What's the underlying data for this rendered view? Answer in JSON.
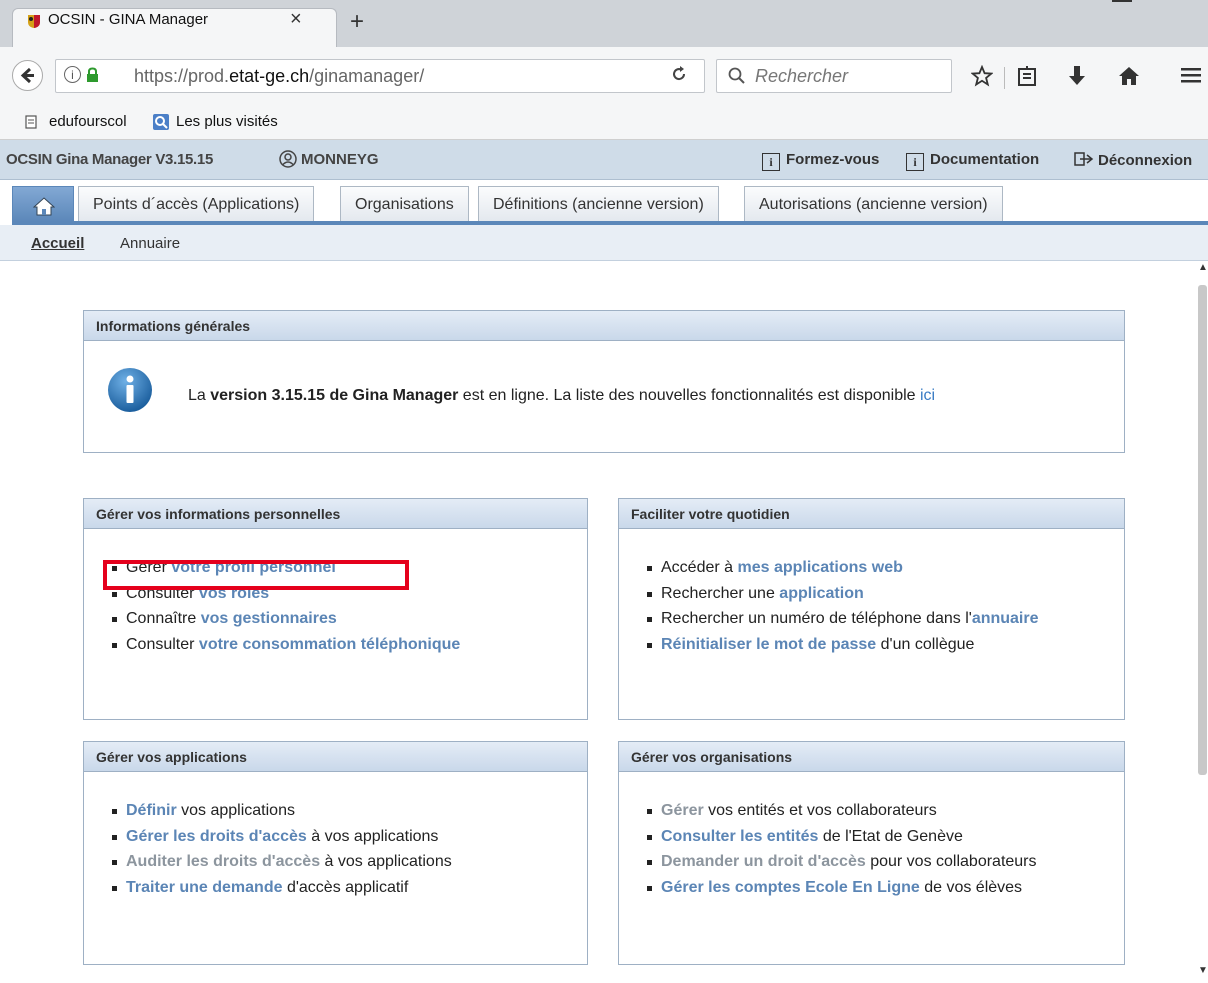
{
  "browser": {
    "tab_title": "OCSIN - GINA Manager",
    "tab_close": "×",
    "new_tab": "+",
    "url_prefix": "https://prod.",
    "url_domain": "etat-ge.ch",
    "url_path": "/ginamanager/",
    "search_placeholder": "Rechercher",
    "bookmarks": [
      "edufourscol",
      "Les plus visités"
    ]
  },
  "app": {
    "title": "OCSIN Gina Manager V3.15.15",
    "user": "MONNEYG",
    "links": [
      "Formez-vous",
      "Documentation",
      "Déconnexion"
    ],
    "tabs": [
      "Points d´accès (Applications)",
      "Organisations",
      "Définitions (ancienne version)",
      "Autorisations (ancienne version)"
    ],
    "subnav": [
      "Accueil",
      "Annuaire"
    ]
  },
  "info_panel": {
    "title": "Informations générales",
    "t1": "La ",
    "t2": "version 3.15.15 de Gina Manager",
    "t3": " est en ligne. La liste des nouvelles fonctionnalités est disponible ",
    "t4": "ici"
  },
  "perso_panel": {
    "title": "Gérer vos informations personnelles",
    "items": [
      {
        "pre": "Gérer ",
        "link": "votre profil personnel",
        "post": ""
      },
      {
        "pre": "Consulter ",
        "link": "vos rôles",
        "post": ""
      },
      {
        "pre": "Connaître ",
        "link": "vos gestionnaires",
        "post": ""
      },
      {
        "pre": "Consulter ",
        "link": "votre consommation téléphonique",
        "post": ""
      }
    ]
  },
  "quot_panel": {
    "title": "Faciliter votre quotidien",
    "items": [
      {
        "pre": "Accéder à ",
        "link": "mes applications web",
        "post": ""
      },
      {
        "pre": "Rechercher une ",
        "link": "application",
        "post": ""
      },
      {
        "pre": "Rechercher un numéro de téléphone dans l'",
        "link": "annuaire",
        "post": ""
      },
      {
        "pre": "",
        "link": "Réinitialiser le mot de passe",
        "post": " d'un collègue"
      }
    ]
  },
  "apps_panel": {
    "title": "Gérer vos applications",
    "items": [
      {
        "pre": "",
        "link": "Définir",
        "post": " vos applications"
      },
      {
        "pre": "",
        "link": "Gérer les droits d'accès",
        "post": " à vos applications"
      },
      {
        "pre": "",
        "link": "Auditer les droits d'accès",
        "post": " à vos applications"
      },
      {
        "pre": "",
        "link": "Traiter une demande",
        "post": " d'accès applicatif"
      }
    ]
  },
  "orgs_panel": {
    "title": "Gérer vos organisations",
    "items": [
      {
        "pre": "",
        "link": "Gérer",
        "post": " vos entités et vos collaborateurs"
      },
      {
        "pre": "",
        "link": "Consulter les entités",
        "post": " de l'Etat de Genève"
      },
      {
        "pre": "",
        "link": "Demander un droit d'accès",
        "post": " pour vos collaborateurs"
      },
      {
        "pre": "",
        "link": "Gérer les comptes Ecole En Ligne",
        "post": " de vos élèves"
      }
    ]
  },
  "colors": {
    "link": "#5b85b5",
    "link_disabled": "#8c959e",
    "highlight": "#e5001c",
    "tab_accent": "#5b87b9"
  }
}
